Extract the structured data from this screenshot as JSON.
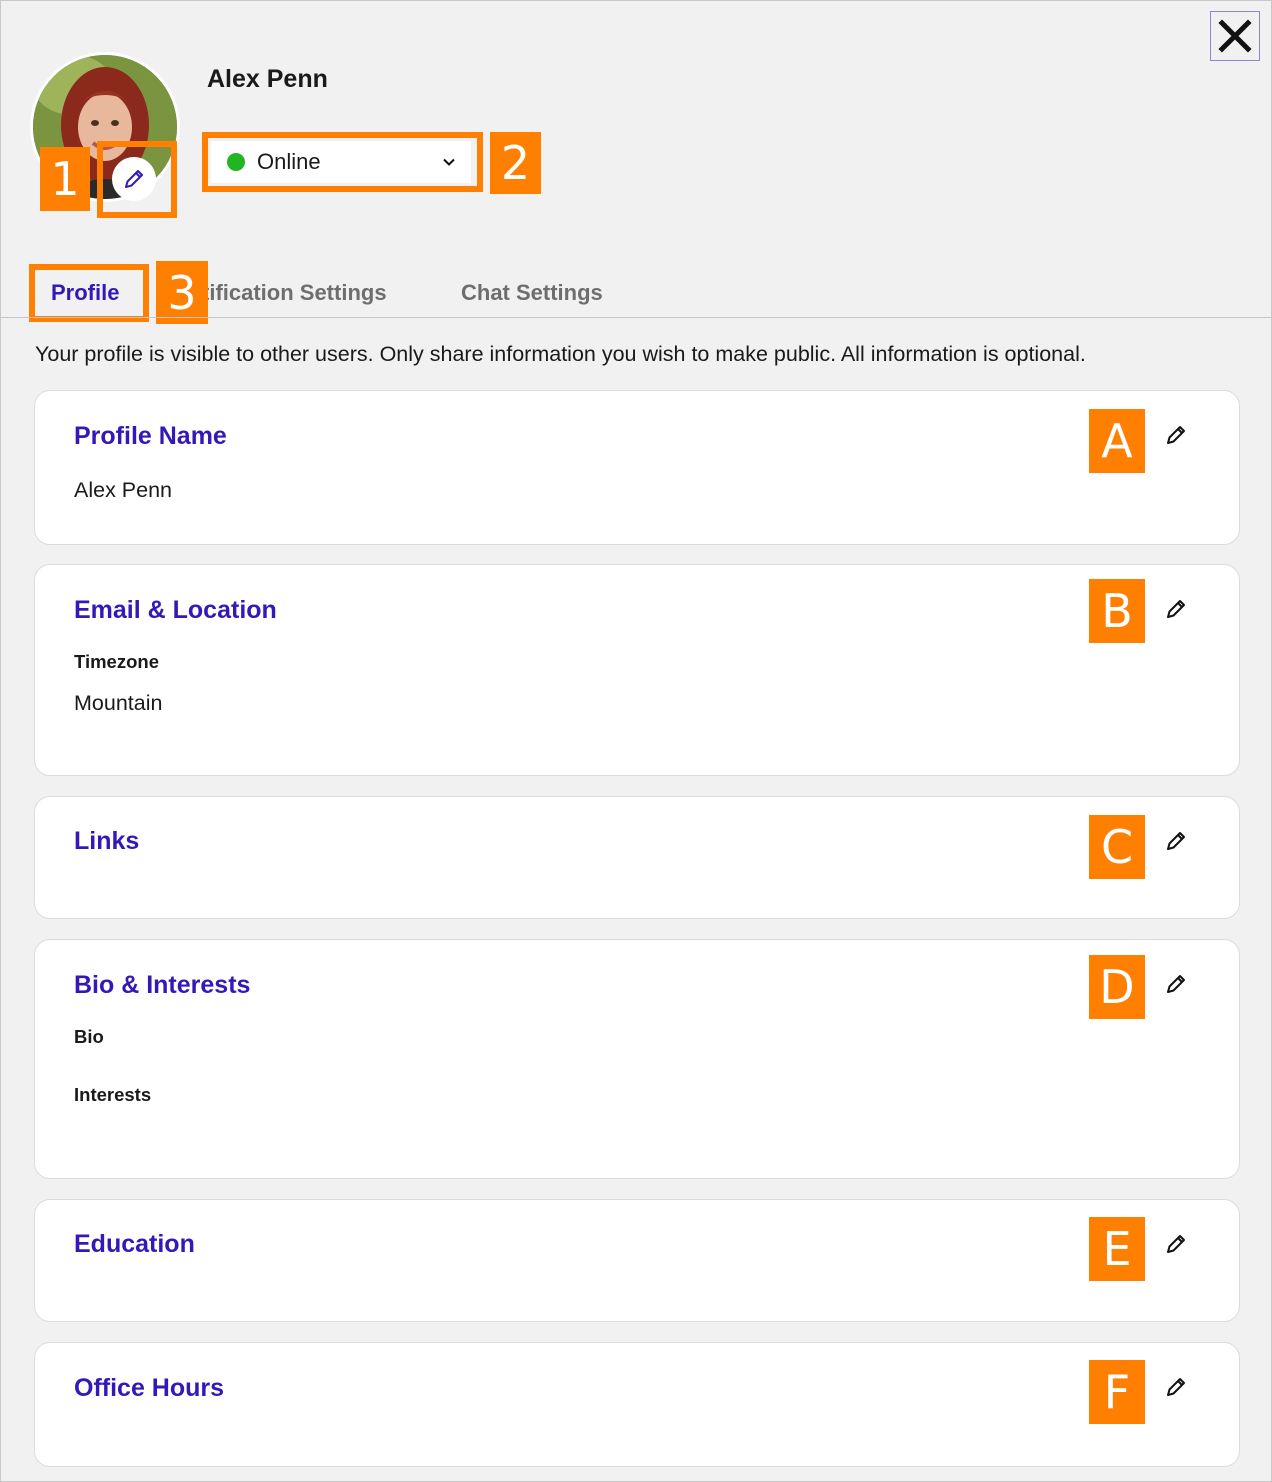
{
  "header": {
    "user_name": "Alex Penn",
    "status": {
      "label": "Online",
      "color": "#22b422"
    }
  },
  "tabs": [
    {
      "label": "Profile",
      "active": true
    },
    {
      "label": "tification Settings",
      "active": false
    },
    {
      "label": "Chat Settings",
      "active": false
    }
  ],
  "intro_text": "Your profile is visible to other users. Only share information you wish to make public. All information is optional.",
  "cards": [
    {
      "title": "Profile Name",
      "value": "Alex Penn",
      "marker": "A"
    },
    {
      "title": "Email & Location",
      "sub_label": "Timezone",
      "value": "Mountain",
      "marker": "B"
    },
    {
      "title": "Links",
      "marker": "C"
    },
    {
      "title": "Bio & Interests",
      "sub_labels": [
        "Bio",
        "Interests"
      ],
      "marker": "D"
    },
    {
      "title": "Education",
      "marker": "E"
    },
    {
      "title": "Office Hours",
      "marker": "F"
    }
  ],
  "callouts": [
    "1",
    "2",
    "3"
  ],
  "colors": {
    "accent": "#3617b8",
    "callout": "#ff8000",
    "background": "#f1f1f1"
  },
  "icons": [
    "close-icon",
    "pencil-icon",
    "chevron-down-icon"
  ]
}
